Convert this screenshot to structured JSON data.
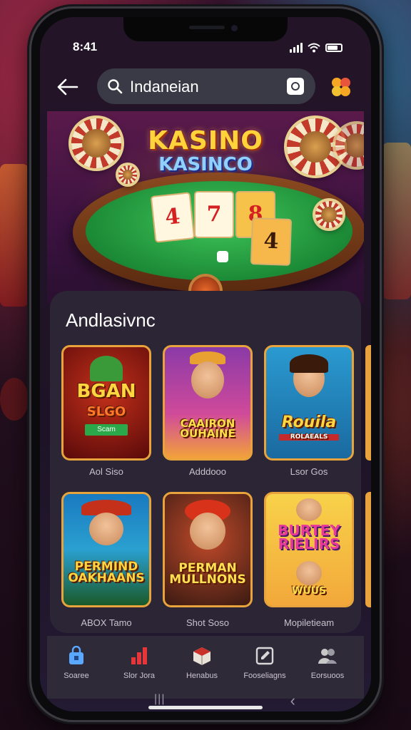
{
  "status_bar": {
    "time": "8:41"
  },
  "search": {
    "value": "Indaneian",
    "placeholder": "Indaneian"
  },
  "hero": {
    "title_line1": "KASINO",
    "title_line2": "KASINCO",
    "cards": [
      "4",
      "7",
      "8",
      "4"
    ]
  },
  "section": {
    "title": "Andlasivnc"
  },
  "games": [
    {
      "label": "Aol Siso",
      "title": "BGAN",
      "subtitle": "SLGO",
      "tag": "Scam"
    },
    {
      "label": "Adddooo",
      "title": "CAAIRON OUHAINE",
      "subtitle": ""
    },
    {
      "label": "Lsor Gos",
      "title": "Rouila",
      "subtitle": "ROLAEALS"
    },
    {
      "label": "ABOX Tamo",
      "title": "PERMIND OAKHAANS",
      "subtitle": ""
    },
    {
      "label": "Shot Soso",
      "title": "PERMAN MULLNONS",
      "subtitle": ""
    },
    {
      "label": "Mopiletieam",
      "title": "BURTEY RIELIRS",
      "subtitle": "WUUS"
    }
  ],
  "bottom_nav": [
    {
      "label": "Soaree",
      "icon": "bag-icon",
      "color": "#5aa8ff"
    },
    {
      "label": "Slor Jora",
      "icon": "bars-icon",
      "color": "#e8353a"
    },
    {
      "label": "Henabus",
      "icon": "box-icon",
      "color": "#e8e2d8"
    },
    {
      "label": "Fooseliagns",
      "icon": "edit-icon",
      "color": "#d8d8d8"
    },
    {
      "label": "Eorsuoos",
      "icon": "users-icon",
      "color": "#c8c8c8"
    }
  ],
  "system_nav": {
    "menu": "|||",
    "back": "‹"
  }
}
